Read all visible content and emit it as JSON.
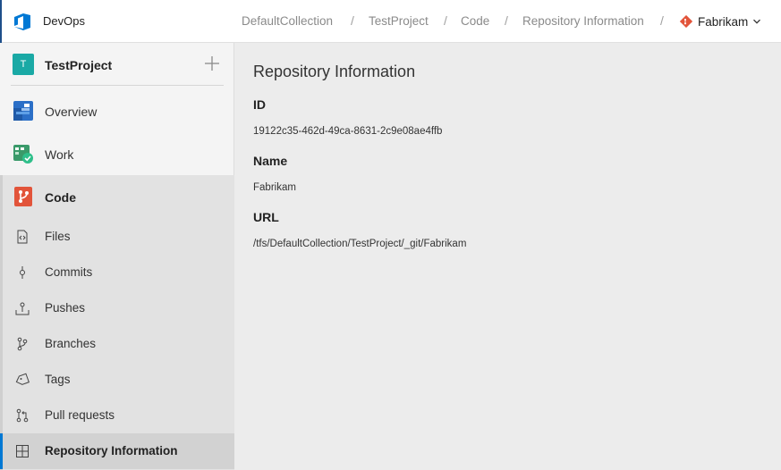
{
  "app": {
    "name": "DevOps"
  },
  "breadcrumb": [
    "DefaultCollection",
    "TestProject",
    "Code",
    "Repository Information"
  ],
  "repo_picker": {
    "label": "Fabrikam"
  },
  "project": {
    "initial": "T",
    "name": "TestProject"
  },
  "nav": {
    "overview": "Overview",
    "work": "Work",
    "code": "Code"
  },
  "code_items": [
    {
      "label": "Files",
      "icon": "file-code-icon"
    },
    {
      "label": "Commits",
      "icon": "commit-icon"
    },
    {
      "label": "Pushes",
      "icon": "push-icon"
    },
    {
      "label": "Branches",
      "icon": "branch-icon"
    },
    {
      "label": "Tags",
      "icon": "tag-icon"
    },
    {
      "label": "Pull requests",
      "icon": "pull-request-icon"
    },
    {
      "label": "Repository Information",
      "icon": "grid-icon",
      "selected": true
    }
  ],
  "main": {
    "title": "Repository Information",
    "fields": [
      {
        "label": "ID",
        "value": "19122c35-462d-49ca-8631-2c9e08ae4ffb"
      },
      {
        "label": "Name",
        "value": "Fabrikam"
      },
      {
        "label": "URL",
        "value": "/tfs/DefaultCollection/TestProject/_git/Fabrikam"
      }
    ]
  },
  "colors": {
    "accent": "#0078d4",
    "project_avatar": "#1aa9a5",
    "code_icon": "#e2543a",
    "git_icon": "#e2543a"
  }
}
